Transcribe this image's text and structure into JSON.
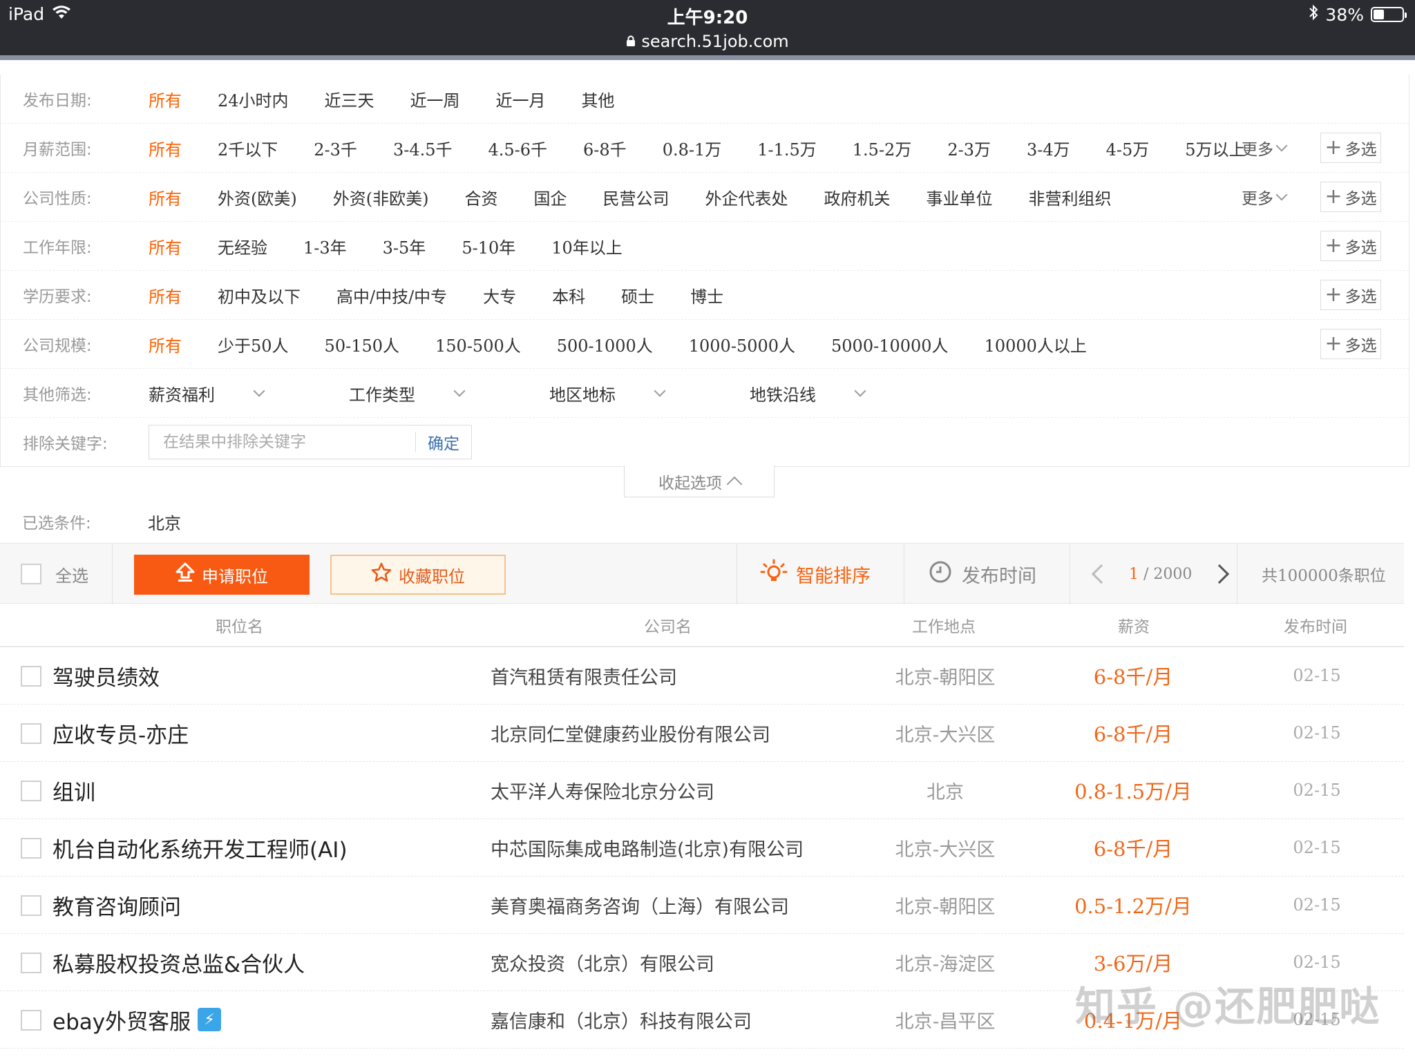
{
  "status_bar": {
    "device": "iPad",
    "time": "上午9:20",
    "url": "search.51job.com",
    "battery_percent": "38%",
    "battery_level": 0.38
  },
  "filters": {
    "date": {
      "label": "发布日期:",
      "options": [
        "所有",
        "24小时内",
        "近三天",
        "近一周",
        "近一月",
        "其他"
      ]
    },
    "salary": {
      "label": "月薪范围:",
      "options": [
        "所有",
        "2千以下",
        "2-3千",
        "3-4.5千",
        "4.5-6千",
        "6-8千",
        "0.8-1万",
        "1-1.5万",
        "1.5-2万",
        "2-3万",
        "3-4万",
        "4-5万",
        "5万以上"
      ],
      "more": "更多",
      "multi": "多选"
    },
    "company_type": {
      "label": "公司性质:",
      "options": [
        "所有",
        "外资(欧美)",
        "外资(非欧美)",
        "合资",
        "国企",
        "民营公司",
        "外企代表处",
        "政府机关",
        "事业单位",
        "非营利组织"
      ],
      "more": "更多",
      "multi": "多选"
    },
    "experience": {
      "label": "工作年限:",
      "options": [
        "所有",
        "无经验",
        "1-3年",
        "3-5年",
        "5-10年",
        "10年以上"
      ],
      "multi": "多选"
    },
    "education": {
      "label": "学历要求:",
      "options": [
        "所有",
        "初中及以下",
        "高中/中技/中专",
        "大专",
        "本科",
        "硕士",
        "博士"
      ],
      "multi": "多选"
    },
    "company_size": {
      "label": "公司规模:",
      "options": [
        "所有",
        "少于50人",
        "50-150人",
        "150-500人",
        "500-1000人",
        "1000-5000人",
        "5000-10000人",
        "10000人以上"
      ],
      "multi": "多选"
    },
    "other": {
      "label": "其他筛选:",
      "dropdowns": [
        "薪资福利",
        "工作类型",
        "地区地标",
        "地铁沿线"
      ]
    },
    "exclude": {
      "label": "排除关键字:",
      "placeholder": "在结果中排除关键字",
      "confirm": "确定"
    },
    "collapse": "收起选项",
    "selected": {
      "label": "已选条件:",
      "value": "北京"
    }
  },
  "toolbar": {
    "select_all": "全选",
    "apply": "申请职位",
    "favorite": "收藏职位",
    "sort_smart": "智能排序",
    "sort_time": "发布时间",
    "page_current": "1",
    "page_total": " / 2000",
    "total": "共100000条职位"
  },
  "table": {
    "headers": {
      "job": "职位名",
      "company": "公司名",
      "location": "工作地点",
      "salary": "薪资",
      "date": "发布时间"
    },
    "rows": [
      {
        "job": "驾驶员绩效",
        "company": "首汽租赁有限责任公司",
        "location": "北京-朝阳区",
        "salary": "6-8千/月",
        "date": "02-15"
      },
      {
        "job": "应收专员-亦庄",
        "company": "北京同仁堂健康药业股份有限公司",
        "location": "北京-大兴区",
        "salary": "6-8千/月",
        "date": "02-15"
      },
      {
        "job": "组训",
        "company": "太平洋人寿保险北京分公司",
        "location": "北京",
        "salary": "0.8-1.5万/月",
        "date": "02-15"
      },
      {
        "job": "机台自动化系统开发工程师(AI)",
        "company": "中芯国际集成电路制造(北京)有限公司",
        "location": "北京-大兴区",
        "salary": "6-8千/月",
        "date": "02-15"
      },
      {
        "job": "教育咨询顾问",
        "company": "美育奥福商务咨询（上海）有限公司",
        "location": "北京-朝阳区",
        "salary": "0.5-1.2万/月",
        "date": "02-15"
      },
      {
        "job": "私募股权投资总监&合伙人",
        "company": "宽众投资（北京）有限公司",
        "location": "北京-海淀区",
        "salary": "3-6万/月",
        "date": "02-15"
      },
      {
        "job": "ebay外贸客服",
        "company": "嘉信康和（北京）科技有限公司",
        "location": "北京-昌平区",
        "salary": "0.4-1万/月",
        "date": "02-15",
        "badge": "flash-icon"
      }
    ]
  },
  "watermark": "知乎 @还肥肥哒",
  "colors": {
    "accent": "#ff6000",
    "apply_button": "#f95a13",
    "status_bar": "#2b2c31"
  }
}
